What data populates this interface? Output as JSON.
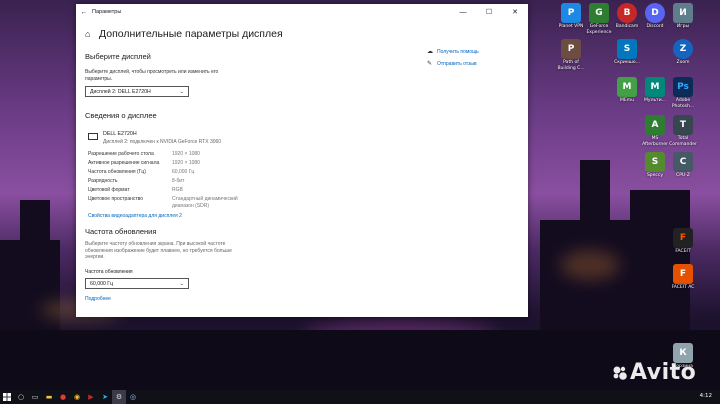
{
  "window": {
    "title": "Параметры",
    "heading": "Дополнительные параметры дисплея",
    "select_display": {
      "title": "Выберите дисплей",
      "description": "Выберите дисплей, чтобы просмотреть или изменить его параметры.",
      "dropdown_value": "Дисплей 2: DELL E2720H"
    },
    "display_info": {
      "title": "Сведения о дисплее",
      "monitor_name": "DELL E2720H",
      "monitor_sub": "Дисплей 2: подключен к NVIDIA GeForce RTX 3060",
      "rows": [
        {
          "label": "Разрешение рабочего стола",
          "value": "1920 × 1080"
        },
        {
          "label": "Активное разрешение сигнала",
          "value": "1920 × 1080"
        },
        {
          "label": "Частота обновления (Гц)",
          "value": "60,000 Гц"
        },
        {
          "label": "Разрядность",
          "value": "8-бит"
        },
        {
          "label": "Цветовой формат",
          "value": "RGB"
        },
        {
          "label": "Цветовое пространство",
          "value": "Стандартный динамический диапазон (SDR)"
        }
      ],
      "adapter_link": "Свойства видеоадаптера для дисплея 2"
    },
    "refresh": {
      "title": "Частота обновления",
      "description": "Выберите частоту обновления экрана. При высокой частоте обновления изображение будет плавнее, но требуется больше энергии.",
      "label": "Частота обновления",
      "dropdown_value": "60,000 Гц",
      "more_link": "Подробнее"
    },
    "side_links": [
      {
        "label": "Получить помощь",
        "icon": "help-icon"
      },
      {
        "label": "Отправить отзыв",
        "icon": "feedback-icon"
      }
    ]
  },
  "desktop_icons": [
    {
      "label": "Planet VPN",
      "color": "#1e88e5",
      "glyph": "P"
    },
    {
      "label": "GeForce Experience",
      "color": "#2e7d32",
      "glyph": "G"
    },
    {
      "label": "Bandicam",
      "color": "#c62828",
      "glyph": "B"
    },
    {
      "label": "Discord",
      "color": "#5865f2",
      "glyph": "D"
    },
    {
      "label": "Игры",
      "color": "#607d8b",
      "glyph": "И"
    },
    {
      "label": "Path of Building C...",
      "color": "#6d4c41",
      "glyph": "P"
    },
    {
      "label": "Скриншо...",
      "color": "#0277bd",
      "glyph": "S"
    },
    {
      "label": "Zoom",
      "color": "#1565c0",
      "glyph": "Z"
    },
    {
      "label": "MEmu",
      "color": "#43a047",
      "glyph": "M"
    },
    {
      "label": "Мульти...",
      "color": "#00897b",
      "glyph": "M"
    },
    {
      "label": "Adobe Photosh...",
      "color": "#0d2b57",
      "glyph": "Ps"
    },
    {
      "label": "MS Afterburner",
      "color": "#2e7d32",
      "glyph": "A"
    },
    {
      "label": "Total Commander",
      "color": "#37474f",
      "glyph": "T"
    },
    {
      "label": "Speccy",
      "color": "#558b2f",
      "glyph": "S"
    },
    {
      "label": "CPU-Z",
      "color": "#455a64",
      "glyph": "C"
    },
    {
      "label": "FACEIT",
      "color": "#222222",
      "glyph": "F"
    },
    {
      "label": "FACEIT AC",
      "color": "#e65100",
      "glyph": "F"
    },
    {
      "label": "Корзина",
      "color": "#90a4ae",
      "glyph": "К"
    }
  ],
  "taskbar": {
    "start_icon": "windows-logo",
    "clock": "4:12"
  },
  "watermark": "Avito"
}
